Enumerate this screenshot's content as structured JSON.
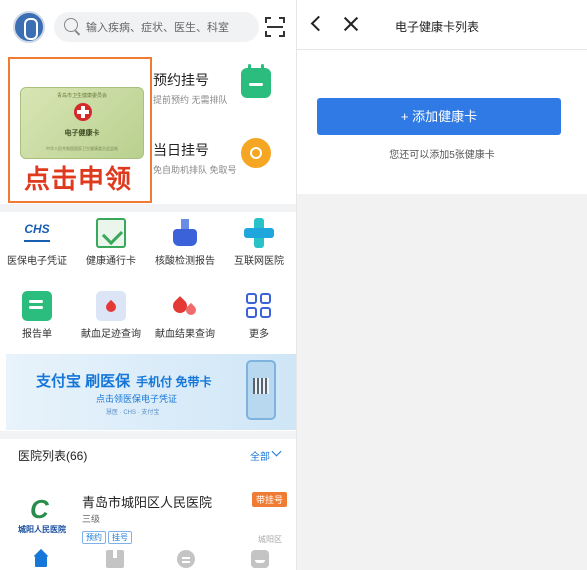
{
  "left": {
    "search": {
      "placeholder": "输入疾病、症状、医生、科室"
    },
    "promo": {
      "card_issuer": "青岛市卫生健康委员会",
      "card_title": "电子健康卡",
      "card_footer": "中华人民共和国国家卫生健康委员会监制",
      "claim": "点击申领"
    },
    "quick_actions": [
      {
        "title": "预约挂号",
        "subtitle": "提前预约 无需排队",
        "icon": "calendar-icon",
        "color": "#2bbd7e"
      },
      {
        "title": "当日挂号",
        "subtitle": "免自助机排队 免取号",
        "icon": "sun-icon",
        "color": "#f5a623"
      }
    ],
    "services": [
      {
        "label": "医保电子凭证",
        "icon": "chs-insurance-icon",
        "logo_text": "CHS",
        "logo_sub": "中国医疗保障"
      },
      {
        "label": "健康通行卡",
        "icon": "health-pass-icon"
      },
      {
        "label": "核酸检测报告",
        "icon": "flask-icon"
      },
      {
        "label": "互联网医院",
        "icon": "cross-icon"
      },
      {
        "label": "报告单",
        "icon": "report-icon"
      },
      {
        "label": "献血足迹查询",
        "icon": "blood-record-icon"
      },
      {
        "label": "献血结果查询",
        "icon": "blood-drops-icon"
      },
      {
        "label": "更多",
        "icon": "grid-more-icon"
      }
    ],
    "banner": {
      "headline": "支付宝 刷医保",
      "headline_suffix": "手机付 免带卡",
      "subline": "点击领医保电子凭证",
      "partners": "慧医 · CHS · 支付宝"
    },
    "hospital_list": {
      "title": "医院列表(66)",
      "all_label": "全部",
      "items": [
        {
          "name": "青岛市城阳区人民医院",
          "level": "三级",
          "logo_text": "城阳人民医院",
          "badge": "带挂号",
          "tags": [
            "预约",
            "挂号"
          ],
          "district": "城阳区"
        }
      ]
    },
    "tabbar": [
      "home-icon",
      "card-icon",
      "chat-icon",
      "profile-icon"
    ]
  },
  "right": {
    "title": "电子健康卡列表",
    "add_button": "+ 添加健康卡",
    "hint": "您还可以添加5张健康卡",
    "accent": "#2f7ae5"
  }
}
